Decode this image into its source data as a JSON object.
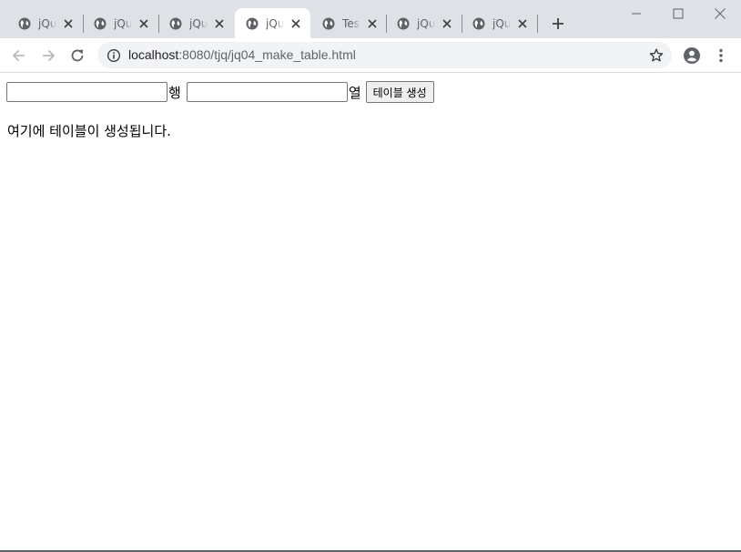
{
  "browser": {
    "tabs": [
      {
        "title": "jQuery",
        "active": false
      },
      {
        "title": "jQuery",
        "active": false
      },
      {
        "title": "jQuery",
        "active": false
      },
      {
        "title": "jQuery",
        "active": true
      },
      {
        "title": "Test",
        "active": false
      },
      {
        "title": "jQuery",
        "active": false
      },
      {
        "title": "jQuery",
        "active": false
      }
    ],
    "url_host": "localhost",
    "url_path": ":8080/tjq/jq04_make_table.html"
  },
  "page": {
    "rows_input_value": "",
    "rows_unit": "행",
    "cols_input_value": "",
    "cols_unit": "열",
    "create_button_label": "테이블 생성",
    "result_text": "여기에 테이블이 생성됩니다."
  },
  "colors": {
    "tabstrip_bg": "#dee1e6",
    "omnibox_bg": "#f1f3f4",
    "icon_gray": "#5f6368"
  }
}
